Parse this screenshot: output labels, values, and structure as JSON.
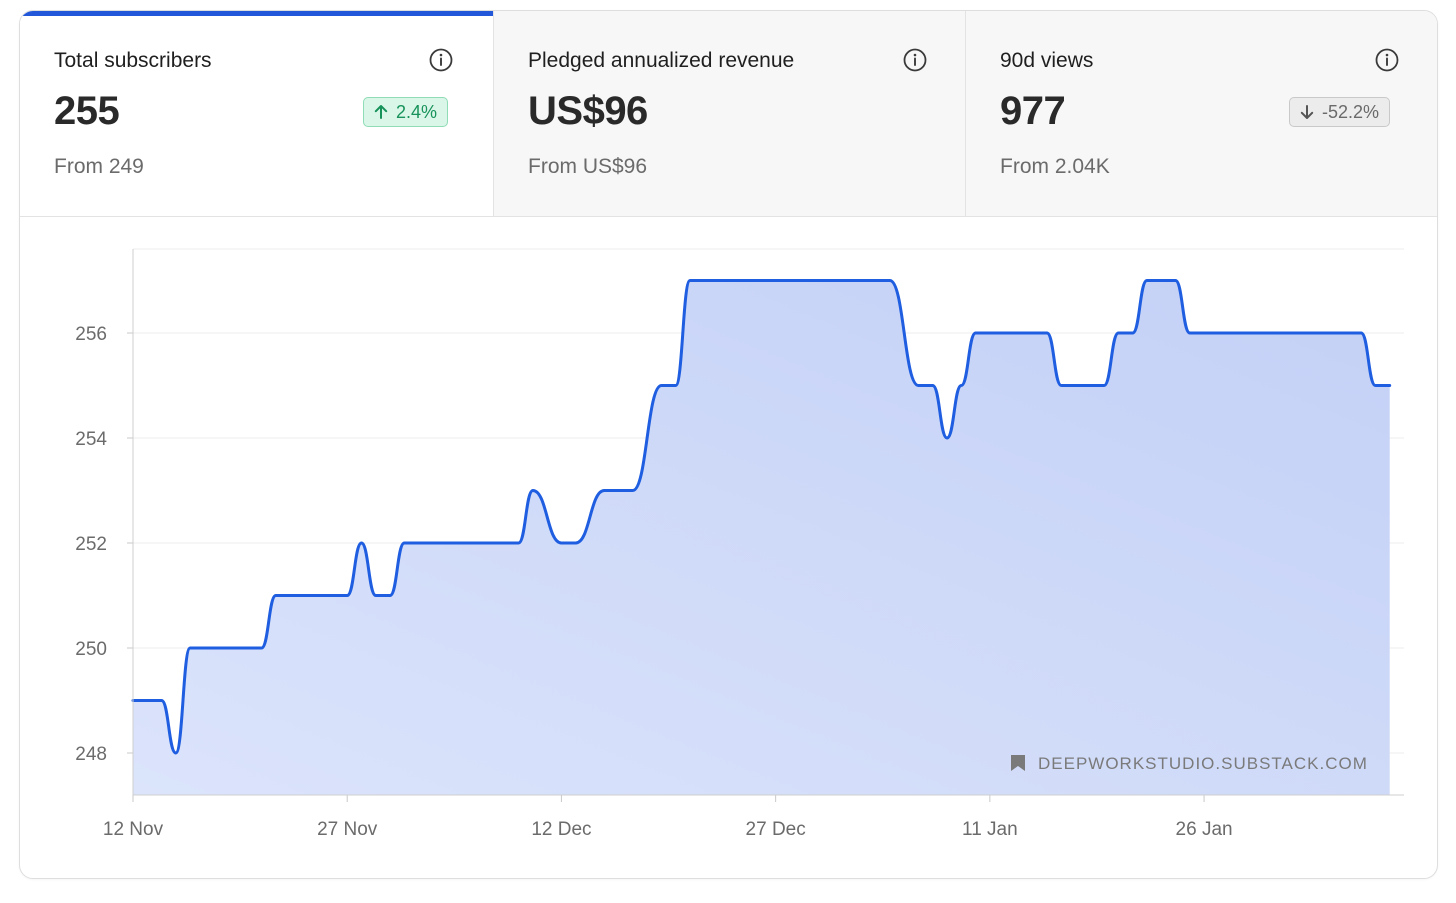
{
  "metrics": [
    {
      "label": "Total subscribers",
      "value": "255",
      "badge": "2.4%",
      "badge_direction": "up",
      "from": "From 249",
      "icon": "info-icon"
    },
    {
      "label": "Pledged annualized revenue",
      "value": "US$96",
      "badge": "",
      "badge_direction": "none",
      "from": "From US$96",
      "icon": "info-icon"
    },
    {
      "label": "90d views",
      "value": "977",
      "badge": "-52.2%",
      "badge_direction": "down",
      "from": "From 2.04K",
      "icon": "info-icon"
    }
  ],
  "watermark": "DEEPWORKSTUDIO.SUBSTACK.COM",
  "colors": {
    "accent": "#2157d8",
    "line": "#1f5ee0",
    "fill_top": "#c3d0f6",
    "fill_bottom": "#dbe4fb",
    "up": "#17925a",
    "down": "#6a6a6a"
  },
  "chart_data": {
    "type": "area",
    "title": "",
    "xlabel": "",
    "ylabel": "",
    "x_tick_labels": [
      "12 Nov",
      "27 Nov",
      "12 Dec",
      "27 Dec",
      "11 Jan",
      "26 Jan"
    ],
    "y_tick_labels": [
      "248",
      "250",
      "252",
      "254",
      "256"
    ],
    "ylim": [
      247.2,
      257.6
    ],
    "xlim": [
      "2023-11-12",
      "2024-02-09"
    ],
    "grid": true,
    "series": [
      {
        "x": [
          "2023-11-12",
          "2023-11-14",
          "2023-11-15",
          "2023-11-16",
          "2023-11-17",
          "2023-11-21",
          "2023-11-22",
          "2023-11-26",
          "2023-11-27",
          "2023-11-28",
          "2023-11-29",
          "2023-11-30",
          "2023-12-01",
          "2023-12-08",
          "2023-12-09",
          "2023-12-10",
          "2023-12-12",
          "2023-12-13",
          "2023-12-15",
          "2023-12-16",
          "2023-12-17",
          "2023-12-19",
          "2023-12-20",
          "2023-12-21",
          "2024-01-03",
          "2024-01-04",
          "2024-01-06",
          "2024-01-07",
          "2024-01-08",
          "2024-01-09",
          "2024-01-10",
          "2024-01-11",
          "2024-01-15",
          "2024-01-16",
          "2024-01-19",
          "2024-01-20",
          "2024-01-21",
          "2024-01-22",
          "2024-01-24",
          "2024-01-25",
          "2024-01-31",
          "2024-02-06",
          "2024-02-07",
          "2024-02-08"
        ],
        "y": [
          249,
          249,
          248,
          250,
          250,
          250,
          251,
          251,
          251,
          252,
          251,
          251,
          252,
          252,
          252,
          253,
          252,
          252,
          253,
          253,
          253,
          255,
          255,
          257,
          257,
          257,
          255,
          255,
          254,
          255,
          256,
          256,
          256,
          255,
          255,
          256,
          256,
          257,
          257,
          256,
          256,
          256,
          255,
          255
        ]
      }
    ]
  }
}
